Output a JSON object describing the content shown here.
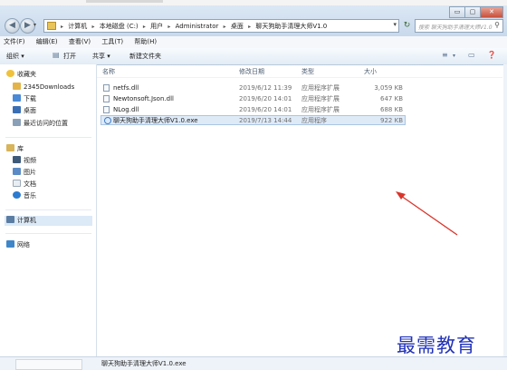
{
  "window": {
    "buttons": [
      "▭",
      "▢",
      "✕"
    ]
  },
  "address": {
    "crumbs": [
      "计算机",
      "本地磁盘 (C:)",
      "用户",
      "Administrator",
      "桌面",
      "聊天狗助手清理大师V1.0"
    ]
  },
  "search": {
    "placeholder": "搜索 聊天狗助手清理大师V1.0"
  },
  "menu": [
    "文件(F)",
    "编辑(E)",
    "查看(V)",
    "工具(T)",
    "帮助(H)"
  ],
  "toolbar": {
    "organize": "组织 ▾",
    "open": "打开",
    "share": "共享 ▾",
    "new_folder": "新建文件夹"
  },
  "nav": {
    "favorites": "收藏夹",
    "fav_items": [
      "2345Downloads",
      "下载",
      "桌面",
      "最近访问的位置"
    ],
    "libraries": "库",
    "lib_items": [
      "视频",
      "图片",
      "文档",
      "音乐"
    ],
    "computer": "计算机",
    "network": "网络"
  },
  "columns": {
    "name": "名称",
    "date": "修改日期",
    "type": "类型",
    "size": "大小"
  },
  "files": [
    {
      "name": "netfs.dll",
      "date": "2019/6/12 11:39",
      "type": "应用程序扩展",
      "size": "3,059 KB",
      "selected": false,
      "icon": "dll-file-icon"
    },
    {
      "name": "Newtonsoft.Json.dll",
      "date": "2019/6/20 14:01",
      "type": "应用程序扩展",
      "size": "647 KB",
      "selected": false,
      "icon": "dll-file-icon"
    },
    {
      "name": "NLog.dll",
      "date": "2019/6/20 14:01",
      "type": "应用程序扩展",
      "size": "688 KB",
      "selected": false,
      "icon": "dll-file-icon"
    },
    {
      "name": "聊天狗助手清理大师V1.0.exe",
      "date": "2019/7/13 14:44",
      "type": "应用程序",
      "size": "922 KB",
      "selected": true,
      "icon": "exe-file-icon"
    }
  ],
  "status": {
    "selected_name": "聊天狗助手清理大师V1.0.exe"
  },
  "watermark": "最需教育",
  "colors": {
    "accent": "#2233b8",
    "arrow": "#d9352b",
    "selection": "#dfeaf7"
  }
}
